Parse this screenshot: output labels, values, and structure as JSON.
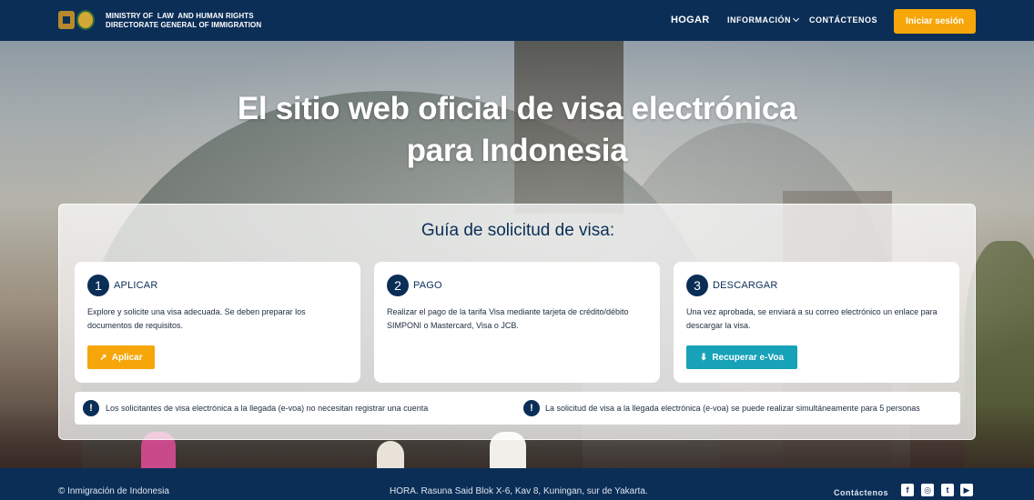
{
  "header": {
    "org_line1": "MINISTRY OF  LAW  AND HUMAN RIGHTS",
    "org_line2": "DIRECTORATE GENERAL OF IMMIGRATION",
    "nav_home": "HOGAR",
    "nav_info": "INFORMACIÓN",
    "nav_contact": "CONTÁCTENOS",
    "login_label": "Iniciar sesión"
  },
  "hero": {
    "title_line1": "El sitio web oficial de visa electrónica",
    "title_line2": "para Indonesia"
  },
  "guide": {
    "title": "Guía de solicitud de visa:",
    "steps": [
      {
        "number": "1",
        "title": "APLICAR",
        "text": "Explore y solicite una visa adecuada. Se deben preparar los documentos de requisitos.",
        "button": "Aplicar"
      },
      {
        "number": "2",
        "title": "PAGO",
        "text": "Realizar el pago de la tarifa Visa mediante tarjeta de crédito/débito SIMPONI o Mastercard, Visa o JCB."
      },
      {
        "number": "3",
        "title": "DESCARGAR",
        "text": "Una vez aprobada, se enviará a su correo electrónico un enlace para descargar la visa.",
        "button": "Recuperar e-Voa"
      }
    ],
    "notices": [
      "Los solicitantes de visa electrónica a la llegada (e-voa) no necesitan registrar una cuenta",
      "La solicitud de visa a la llegada electrónica (e-voa) se puede realizar simultáneamente para 5 personas"
    ]
  },
  "footer": {
    "copyright": "© Inmigración de Indonesia",
    "address": "HORA. Rasuna Said Blok X-6, Kav 8, Kuningan, sur de Yakarta.",
    "contact": "Contáctenos",
    "social_icons": [
      "facebook-icon",
      "instagram-icon",
      "twitter-icon",
      "youtube-icon"
    ]
  },
  "colors": {
    "navy": "#0b2e57",
    "accent_orange": "#f6a609",
    "accent_teal": "#17a2b8"
  }
}
